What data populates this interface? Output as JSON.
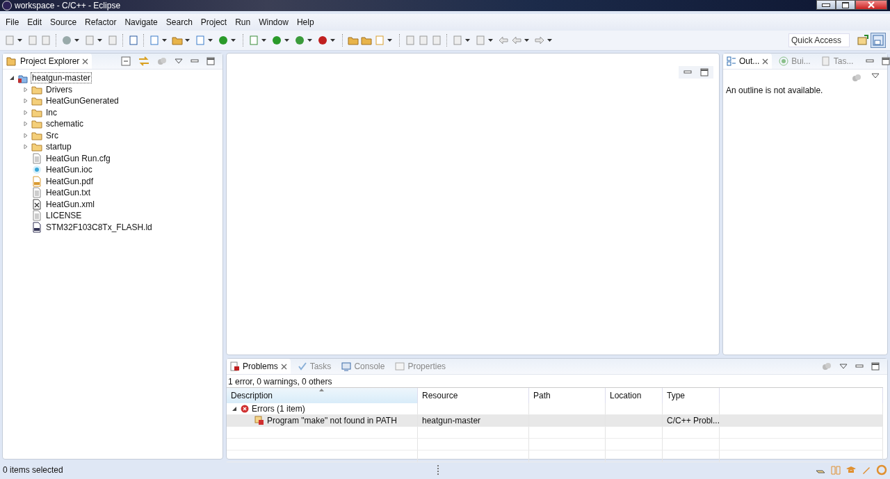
{
  "window": {
    "title": "workspace - C/C++ - Eclipse"
  },
  "menu": [
    "File",
    "Edit",
    "Source",
    "Refactor",
    "Navigate",
    "Search",
    "Project",
    "Run",
    "Window",
    "Help"
  ],
  "toolbar": {
    "quick_access": {
      "placeholder": "Quick Access"
    }
  },
  "project_explorer": {
    "tab": "Project Explorer",
    "tree": [
      {
        "label": "heatgun-master",
        "kind": "project",
        "expanded": true,
        "selected": true,
        "children": [
          {
            "label": "Drivers",
            "kind": "folder",
            "expanded": false,
            "selected": false
          },
          {
            "label": "HeatGunGenerated",
            "kind": "folder",
            "expanded": false,
            "selected": false
          },
          {
            "label": "Inc",
            "kind": "folder",
            "expanded": false,
            "selected": false
          },
          {
            "label": "schematic",
            "kind": "folder",
            "expanded": false,
            "selected": false
          },
          {
            "label": "Src",
            "kind": "folder",
            "expanded": false,
            "selected": false
          },
          {
            "label": "startup",
            "kind": "folder",
            "expanded": false,
            "selected": false
          },
          {
            "label": "HeatGun Run.cfg",
            "kind": "text",
            "selected": false
          },
          {
            "label": "HeatGun.ioc",
            "kind": "ioc",
            "selected": false
          },
          {
            "label": "HeatGun.pdf",
            "kind": "pdf",
            "selected": false
          },
          {
            "label": "HeatGun.txt",
            "kind": "text",
            "selected": false
          },
          {
            "label": "HeatGun.xml",
            "kind": "xml",
            "selected": false
          },
          {
            "label": "LICENSE",
            "kind": "text",
            "selected": false
          },
          {
            "label": "STM32F103C8Tx_FLASH.ld",
            "kind": "linker",
            "selected": false
          }
        ]
      }
    ]
  },
  "outline": {
    "tabs": [
      {
        "label": "Out...",
        "selected": true
      },
      {
        "label": "Bui...",
        "selected": false
      },
      {
        "label": "Tas...",
        "selected": false
      }
    ],
    "message": "An outline is not available."
  },
  "problems": {
    "tabs": [
      {
        "label": "Problems",
        "selected": true
      },
      {
        "label": "Tasks",
        "selected": false
      },
      {
        "label": "Console",
        "selected": false
      },
      {
        "label": "Properties",
        "selected": false
      }
    ],
    "summary": "1 error, 0 warnings, 0 others",
    "columns": [
      "Description",
      "Resource",
      "Path",
      "Location",
      "Type"
    ],
    "groups": [
      {
        "label": "Errors (1 item)",
        "expanded": true,
        "rows": [
          {
            "description": "Program \"make\" not found in PATH",
            "resource": "heatgun-master",
            "type": "C/C++ Probl...",
            "selected": true
          }
        ]
      }
    ]
  },
  "status_bar": {
    "text": "0 items selected"
  }
}
